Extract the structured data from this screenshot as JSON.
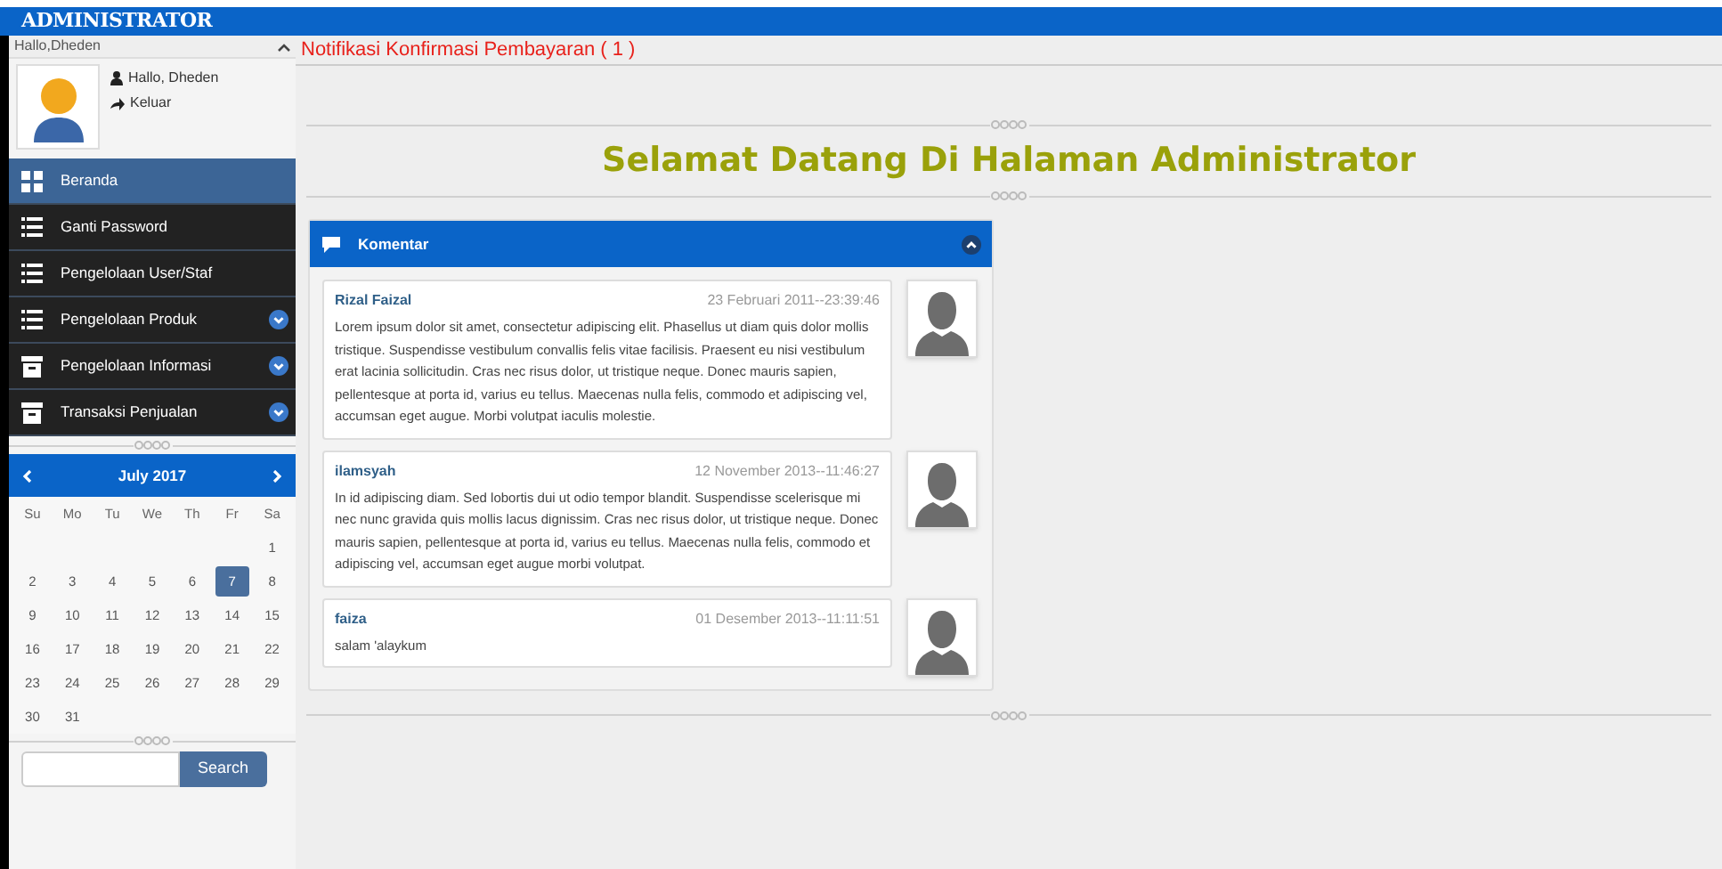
{
  "header": {
    "title": "ADMINISTRATOR"
  },
  "sidebar": {
    "user_bar": {
      "label": "Hallo,Dheden",
      "expanded": true
    },
    "profile": {
      "greeting": "Hallo, Dheden",
      "logout": "Keluar"
    },
    "menu": [
      {
        "label": "Beranda",
        "kind": "grid",
        "selected": true,
        "has_submenu": false
      },
      {
        "label": "Ganti Password",
        "kind": "list",
        "selected": false,
        "has_submenu": false
      },
      {
        "label": "Pengelolaan User/Staf",
        "kind": "list",
        "selected": false,
        "has_submenu": false
      },
      {
        "label": "Pengelolaan Produk",
        "kind": "list",
        "selected": false,
        "has_submenu": true
      },
      {
        "label": "Pengelolaan Informasi",
        "kind": "archive",
        "selected": false,
        "has_submenu": true
      },
      {
        "label": "Transaksi Penjualan",
        "kind": "archive",
        "selected": false,
        "has_submenu": true
      }
    ],
    "calendar": {
      "month": "July 2017",
      "weekdays": [
        "Su",
        "Mo",
        "Tu",
        "We",
        "Th",
        "Fr",
        "Sa"
      ],
      "weeks": [
        [
          {
            "day": "1",
            "selected": false
          }
        ],
        [
          {
            "day": "2",
            "selected": false
          },
          {
            "day": "3",
            "selected": false
          },
          {
            "day": "4",
            "selected": false
          },
          {
            "day": "5",
            "selected": false
          },
          {
            "day": "6",
            "selected": false
          },
          {
            "day": "7",
            "selected": true
          },
          {
            "day": "8",
            "selected": false
          }
        ],
        [
          {
            "day": "9",
            "selected": false
          },
          {
            "day": "10",
            "selected": false
          },
          {
            "day": "11",
            "selected": false
          },
          {
            "day": "12",
            "selected": false
          },
          {
            "day": "13",
            "selected": false
          },
          {
            "day": "14",
            "selected": false
          },
          {
            "day": "15",
            "selected": false
          }
        ],
        [
          {
            "day": "16",
            "selected": false
          },
          {
            "day": "17",
            "selected": false
          },
          {
            "day": "18",
            "selected": false
          },
          {
            "day": "19",
            "selected": false
          },
          {
            "day": "20",
            "selected": false
          },
          {
            "day": "21",
            "selected": false
          },
          {
            "day": "22",
            "selected": false
          }
        ],
        [
          {
            "day": "23",
            "selected": false
          },
          {
            "day": "24",
            "selected": false
          },
          {
            "day": "25",
            "selected": false
          },
          {
            "day": "26",
            "selected": false
          },
          {
            "day": "27",
            "selected": false
          },
          {
            "day": "28",
            "selected": false
          },
          {
            "day": "29",
            "selected": false
          }
        ],
        [
          {
            "day": "30",
            "selected": false
          },
          {
            "day": "31",
            "selected": false
          }
        ]
      ]
    },
    "search": {
      "button": "Search"
    }
  },
  "main": {
    "notification": "Notifikasi Konfirmasi Pembayaran ( 1 )",
    "welcome": "Selamat Datang Di Halaman Administrator",
    "comments_panel": {
      "title": "Komentar",
      "expanded": true,
      "comments": [
        {
          "author": "Rizal Faizal",
          "date": "23 Februari 2011--23:39:46",
          "text": "Lorem ipsum dolor sit amet, consectetur adipiscing elit. Phasellus ut diam quis dolor mollis tristique. Suspendisse vestibulum convallis felis vitae facilisis. Praesent eu nisi vestibulum erat lacinia sollicitudin. Cras nec risus dolor, ut tristique neque. Donec mauris sapien, pellentesque at porta id, varius eu tellus. Maecenas nulla felis, commodo et adipiscing vel, accumsan eget augue. Morbi volutpat iaculis molestie."
        },
        {
          "author": "ilamsyah",
          "date": "12 November 2013--11:46:27",
          "text": "In id adipiscing diam. Sed lobortis dui ut odio tempor blandit. Suspendisse scelerisque mi nec nunc gravida quis mollis lacus dignissim. Cras nec risus dolor, ut tristique neque. Donec mauris sapien, pellentesque at porta id, varius eu tellus. Maecenas nulla felis, commodo et adipiscing vel, accumsan eget augue morbi volutpat."
        },
        {
          "author": "faiza",
          "date": "01 Desember 2013--11:11:51",
          "text": "salam 'alaykum"
        }
      ]
    }
  }
}
